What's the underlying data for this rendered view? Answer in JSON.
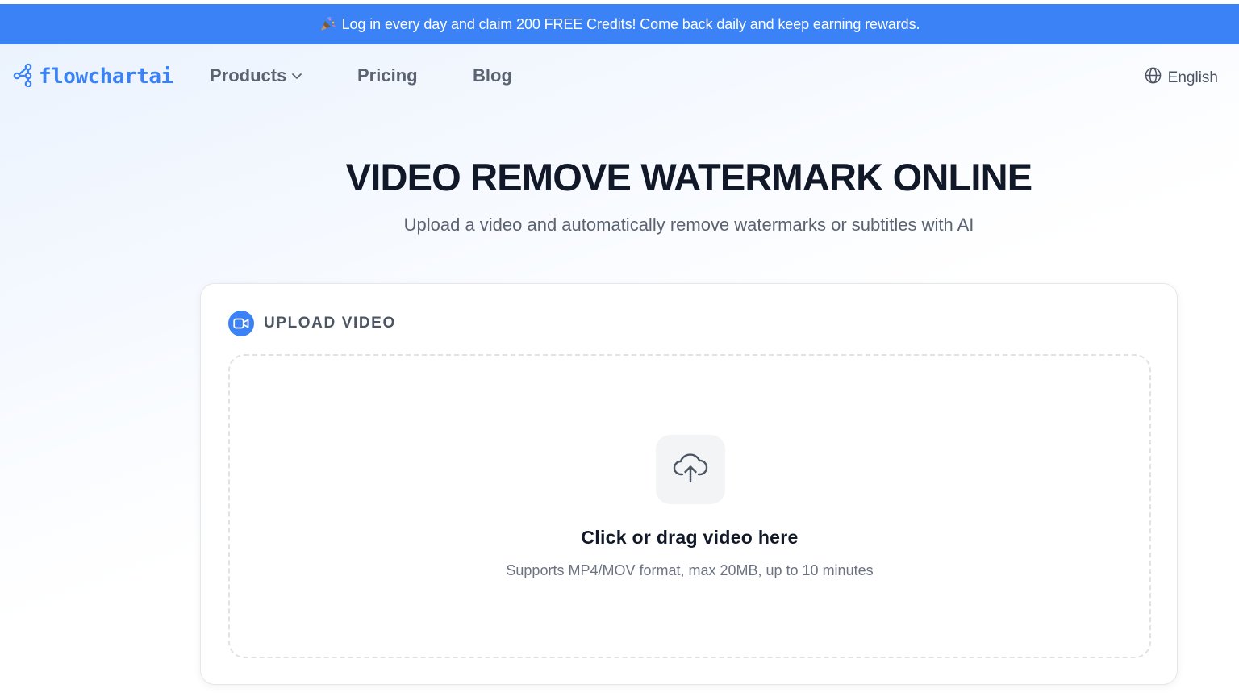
{
  "banner": {
    "text": "Log in every day and claim 200 FREE Credits! Come back daily and keep earning rewards.",
    "icon": "party-popper-icon",
    "background": "#3b82f6"
  },
  "header": {
    "logo_text": "flowchartai",
    "nav": {
      "products": "Products",
      "pricing": "Pricing",
      "blog": "Blog"
    },
    "language": "English"
  },
  "hero": {
    "title": "VIDEO REMOVE WATERMARK ONLINE",
    "subtitle": "Upload a video and automatically remove watermarks or subtitles with AI"
  },
  "upload": {
    "section_title": "UPLOAD VIDEO",
    "drop_title": "Click or drag video here",
    "drop_hint": "Supports MP4/MOV format, max 20MB, up to 10 minutes"
  },
  "colors": {
    "accent": "#3b82f6",
    "text_dark": "#111827",
    "text_muted": "#5b6270"
  }
}
